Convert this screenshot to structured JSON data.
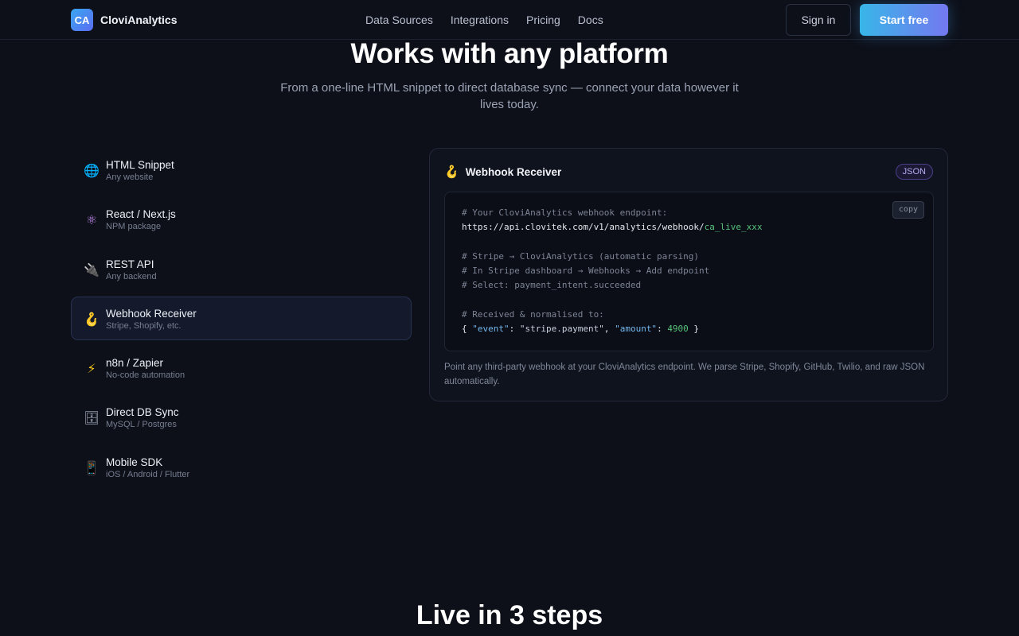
{
  "header": {
    "logo_text": "CA",
    "brand": "CloviAnalytics",
    "nav": [
      "Data Sources",
      "Integrations",
      "Pricing",
      "Docs"
    ],
    "signin": "Sign in",
    "start": "Start free"
  },
  "section": {
    "title": "Works with any platform",
    "subtitle": "From a one-line HTML snippet to direct database sync — connect your data however it lives today."
  },
  "sources": [
    {
      "icon": "🌐",
      "icon_name": "globe-icon",
      "title": "HTML Snippet",
      "subtitle": "Any website",
      "active": false
    },
    {
      "icon": "⚛",
      "icon_name": "react-icon",
      "title": "React / Next.js",
      "subtitle": "NPM package",
      "active": false
    },
    {
      "icon": "🔌",
      "icon_name": "plug-icon",
      "title": "REST API",
      "subtitle": "Any backend",
      "active": false
    },
    {
      "icon": "🪝",
      "icon_name": "hook-icon",
      "title": "Webhook Receiver",
      "subtitle": "Stripe, Shopify, etc.",
      "active": true
    },
    {
      "icon": "⚡",
      "icon_name": "lightning-icon",
      "title": "n8n / Zapier",
      "subtitle": "No-code automation",
      "active": false
    },
    {
      "icon": "🗄",
      "icon_name": "database-icon",
      "title": "Direct DB Sync",
      "subtitle": "MySQL / Postgres",
      "active": false
    },
    {
      "icon": "📱",
      "icon_name": "mobile-icon",
      "title": "Mobile SDK",
      "subtitle": "iOS / Android / Flutter",
      "active": false
    }
  ],
  "detail": {
    "icon": "🪝",
    "title": "Webhook Receiver",
    "badge": "JSON",
    "copy": "copy",
    "code": {
      "l1": "# Your CloviAnalytics webhook endpoint:",
      "l2a": "https://api.clovitek.com/v1/analytics/webhook/",
      "l2b": "ca_live_xxx",
      "l3": "# Stripe → CloviAnalytics (automatic parsing)",
      "l4": "# In Stripe dashboard → Webhooks → Add endpoint",
      "l5": "# Select: payment_intent.succeeded",
      "l6": "# Received & normalised to:",
      "l7_open": "{ ",
      "l7_k1": "\"event\"",
      "l7_c1": ": ",
      "l7_v1": "\"stripe.payment\"",
      "l7_c2": ", ",
      "l7_k2": "\"amount\"",
      "l7_c3": ": ",
      "l7_v2": "4900",
      "l7_close": " }"
    },
    "description": "Point any third-party webhook at your CloviAnalytics endpoint. We parse Stripe, Shopify, GitHub, Twilio, and raw JSON automatically."
  },
  "next_section": {
    "title": "Live in 3 steps"
  }
}
